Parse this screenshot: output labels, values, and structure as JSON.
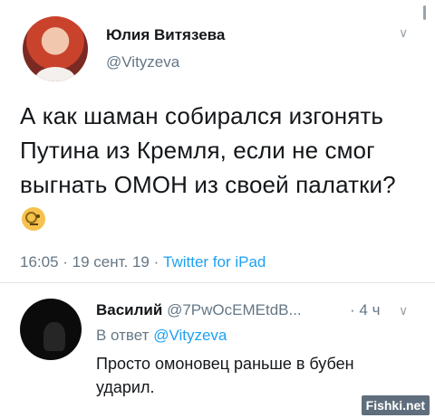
{
  "tweet": {
    "author_name": "Юлия Витязева",
    "author_handle": "@Vityzeva",
    "text": "А как шаман собирался изгонять Путина из Кремля, если не смог выгнать ОМОН из своей палатки?",
    "emoji": "monocle-face",
    "time": "16:05",
    "date": "19 сент. 19",
    "source": "Twitter for iPad"
  },
  "reply": {
    "author_name": "Василий",
    "author_handle": "@7PwOcEMEtdB...",
    "time": "4 ч",
    "reply_prefix": "В ответ",
    "reply_to": "@Vityzeva",
    "text": "Просто омоновец раньше в бубен ударил."
  },
  "watermark": "Fishki.net",
  "colors": {
    "link": "#1da1f2",
    "muted": "#657786"
  }
}
